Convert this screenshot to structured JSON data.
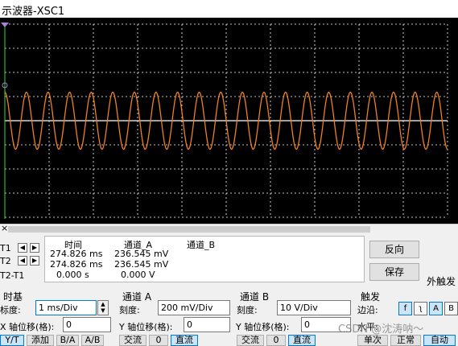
{
  "window": {
    "title": "示波器-XSC1"
  },
  "scope": {
    "colors": {
      "background": "#000000",
      "trace": "#f08020",
      "grid": "#ffffff",
      "cursor": "#2bdc2b"
    },
    "cycles_visible": 20.5,
    "amplitude_div": 1.18
  },
  "readout": {
    "headers": {
      "time": "时间",
      "chA": "通道_A",
      "chB": "通道_B"
    },
    "rows": [
      {
        "label": "T1",
        "time": "274.826 ms",
        "chA": "236.545 mV",
        "chB": ""
      },
      {
        "label": "T2",
        "time": "274.826 ms",
        "chA": "236.545 mV",
        "chB": ""
      },
      {
        "label": "T2-T1",
        "time": "0.000 s",
        "chA": "0.000 V",
        "chB": ""
      }
    ]
  },
  "buttons": {
    "reverse": "反向",
    "save": "保存",
    "ext_trigger": "外触发"
  },
  "timebase": {
    "header": "时基",
    "scale_label": "标度:",
    "scale_value": "1 ms/Div",
    "xpos_label": "X 轴位移(格):",
    "xpos_value": "0",
    "modes": [
      "Y/T",
      "添加",
      "B/A",
      "A/B"
    ]
  },
  "channel_a": {
    "header": "通道 A",
    "scale_label": "刻度:",
    "scale_value": "200 mV/Div",
    "ypos_label": "Y 轴位移(格):",
    "ypos_value": "0",
    "coupling": [
      "交流",
      "0",
      "直流"
    ]
  },
  "channel_b": {
    "header": "通道 B",
    "scale_label": "刻度:",
    "scale_value": "10  V/Div",
    "ypos_label": "Y 轴位移(格):",
    "ypos_value": "0",
    "coupling": [
      "交流",
      "0",
      "直流"
    ]
  },
  "trigger": {
    "header": "触发",
    "edge_label": "边沿:",
    "edge_buttons": [
      "f",
      "ʅ",
      "A",
      "B"
    ],
    "level_label": "水平:",
    "modes": [
      "单次",
      "正常",
      "自动"
    ]
  },
  "watermark": "CSDN @沈涛呐～"
}
